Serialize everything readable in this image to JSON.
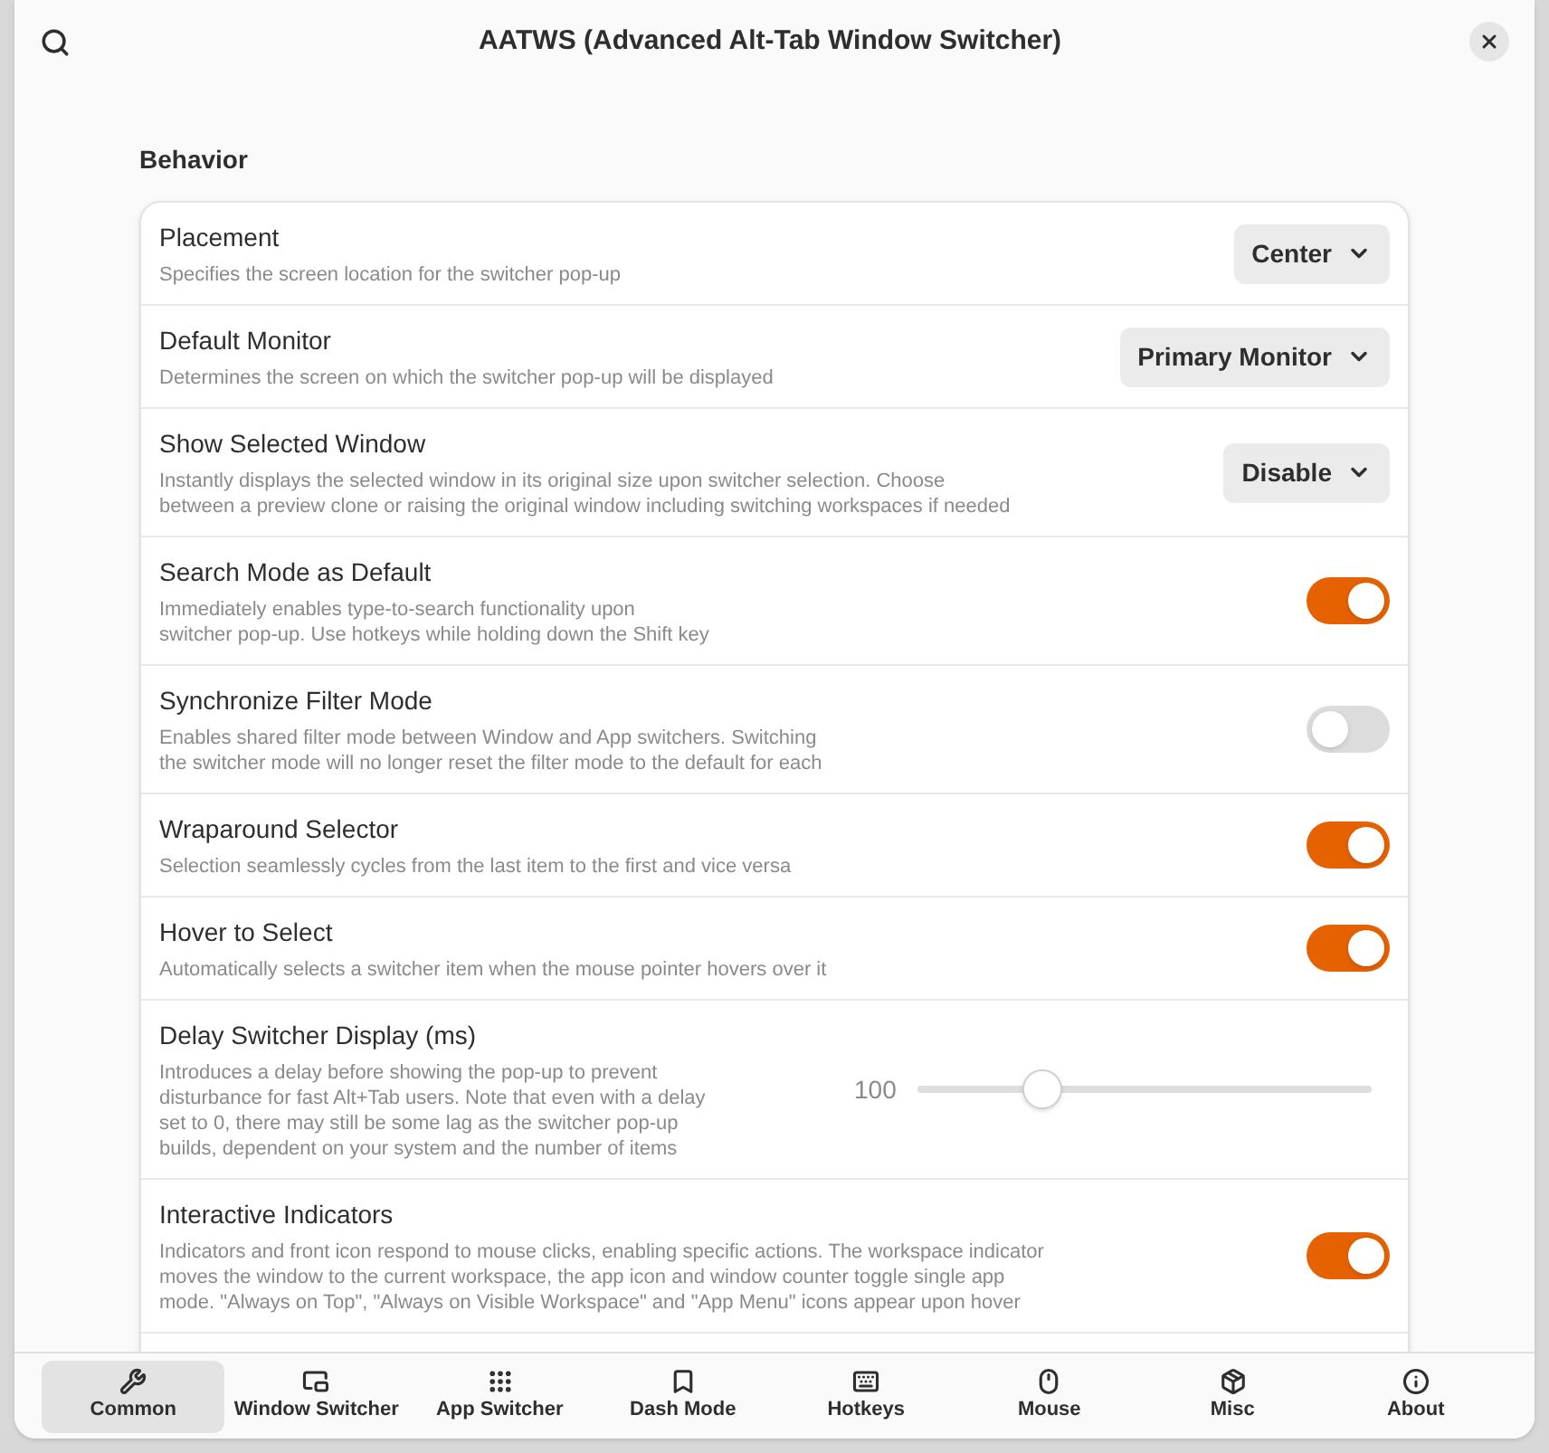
{
  "window": {
    "title": "AATWS (Advanced Alt-Tab Window Switcher)"
  },
  "section": {
    "title": "Behavior"
  },
  "rows": [
    {
      "kind": "dropdown",
      "title": "Placement",
      "description": "Specifies the screen location for the switcher pop-up",
      "value": "Center"
    },
    {
      "kind": "dropdown",
      "title": "Default Monitor",
      "description": "Determines the screen on which the switcher pop-up will be displayed",
      "value": "Primary Monitor"
    },
    {
      "kind": "dropdown",
      "title": "Show Selected Window",
      "description": "Instantly displays the selected window in its original size upon switcher selection. Choose\nbetween a preview clone or raising the original window including switching workspaces if needed",
      "value": "Disable"
    },
    {
      "kind": "switch",
      "title": "Search Mode as Default",
      "description": "Immediately enables type-to-search functionality upon\nswitcher pop-up. Use hotkeys while holding down the Shift key",
      "on": true
    },
    {
      "kind": "switch",
      "title": "Synchronize Filter Mode",
      "description": "Enables shared filter mode between Window and App switchers. Switching\nthe switcher mode will no longer reset the filter mode to the default for each",
      "on": false
    },
    {
      "kind": "switch",
      "title": "Wraparound Selector",
      "description": "Selection seamlessly cycles from the last item to the first and vice versa",
      "on": true
    },
    {
      "kind": "switch",
      "title": "Hover to Select",
      "description": "Automatically selects a switcher item when the mouse pointer hovers over it",
      "on": true
    },
    {
      "kind": "slider",
      "title": "Delay Switcher Display (ms)",
      "description": "Introduces a delay before showing the pop-up to prevent\ndisturbance for fast Alt+Tab users. Note that even with a delay\nset to 0, there may still be some lag as the switcher pop-up\nbuilds, dependent on your system and the number of items",
      "reading": "100",
      "level": 0.25
    },
    {
      "kind": "switch",
      "title": "Interactive Indicators",
      "description": "Indicators and front icon respond to mouse clicks, enabling specific actions. The workspace indicator\nmoves the window to the current workspace, the app icon and window counter toggle single app\nmode. \"Always on Top\", \"Always on Visible Workspace\" and \"App Menu\" icons appear upon hover",
      "on": true
    }
  ],
  "nav": [
    {
      "label": "Common",
      "selected": true
    },
    {
      "label": "Window Switcher",
      "selected": false
    },
    {
      "label": "App Switcher",
      "selected": false
    },
    {
      "label": "Dash Mode",
      "selected": false
    },
    {
      "label": "Hotkeys",
      "selected": false
    },
    {
      "label": "Mouse",
      "selected": false
    },
    {
      "label": "Misc",
      "selected": false
    },
    {
      "label": "About",
      "selected": false
    }
  ]
}
